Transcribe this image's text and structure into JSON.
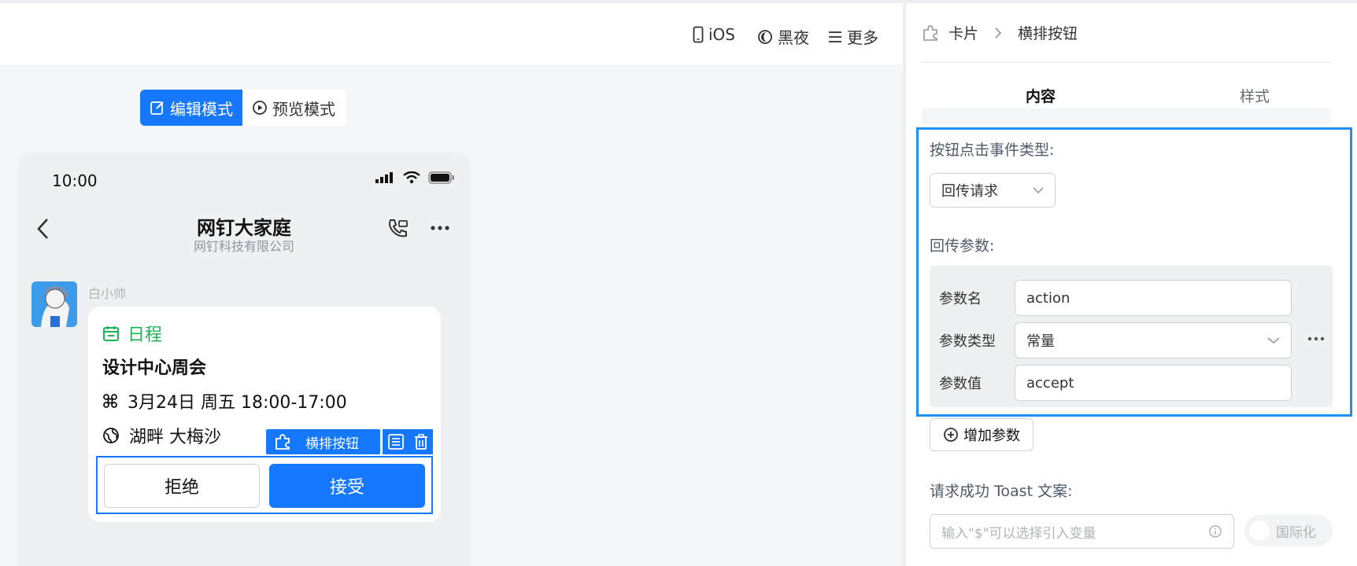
{
  "toolbar": {
    "ios_label": "iOS",
    "dark_label": "黑夜",
    "more_label": "更多"
  },
  "modes": {
    "edit_label": "编辑模式",
    "preview_label": "预览模式"
  },
  "phone": {
    "time": "10:00",
    "chat_title": "网钉大家庭",
    "chat_subtitle": "网钉科技有限公司",
    "sender": "白小帅",
    "card": {
      "tag": "日程",
      "title": "设计中心周会",
      "datetime": "3月24日 周五 18:00-17:00",
      "location": "湖畔 大梅沙",
      "reject_label": "拒绝",
      "accept_label": "接受"
    },
    "selection_label": "横排按钮"
  },
  "panel": {
    "breadcrumb": {
      "root": "卡片",
      "current": "横排按钮"
    },
    "tabs": [
      {
        "label": "内容",
        "active": true
      },
      {
        "label": "样式",
        "active": false
      }
    ],
    "event_type_label": "按钮点击事件类型:",
    "event_type_value": "回传请求",
    "params_label": "回传参数:",
    "params": {
      "name_label": "参数名",
      "name_value": "action",
      "type_label": "参数类型",
      "type_value": "常量",
      "value_label": "参数值",
      "value_value": "accept"
    },
    "add_param_label": "增加参数",
    "toast_label": "请求成功 Toast 文案:",
    "toast_placeholder": "输入\"$\"可以选择引入变量",
    "i18n_label": "国际化"
  },
  "colors": {
    "primary": "#1677ff",
    "highlight": "#1e8ff7",
    "green": "#1eb352"
  }
}
